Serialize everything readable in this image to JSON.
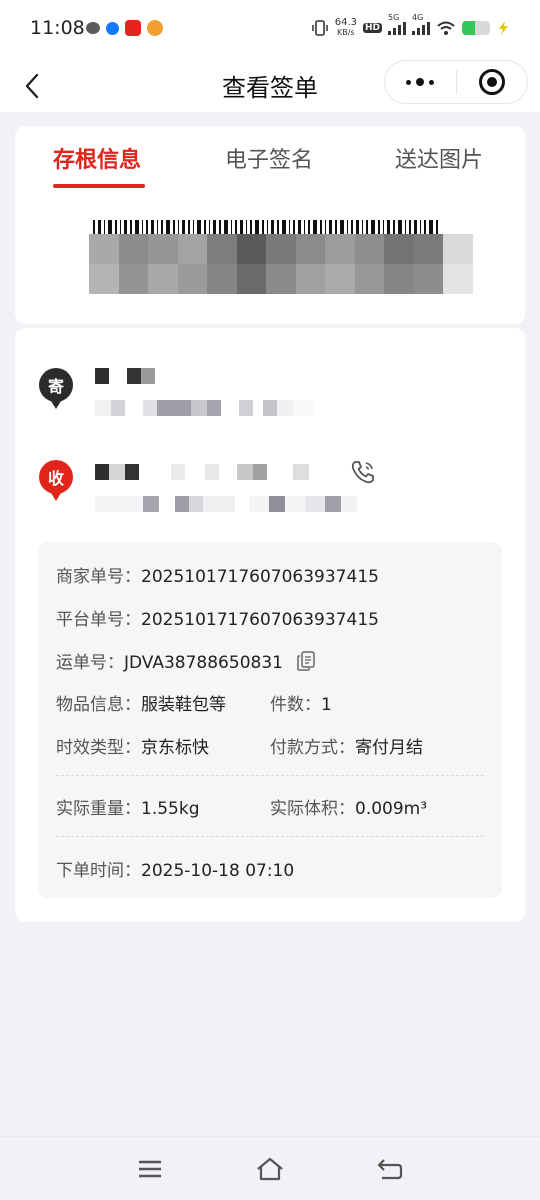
{
  "status_bar": {
    "time": "11:08",
    "net_speed_value": "64.3",
    "net_speed_unit": "KB/s",
    "hd_label": "HD",
    "net_5g": "5G",
    "net_4g": "4G",
    "battery_level": 0.45
  },
  "nav": {
    "title": "查看签单"
  },
  "tabs": [
    {
      "label": "存根信息",
      "active": true
    },
    {
      "label": "电子签名",
      "active": false
    },
    {
      "label": "送达图片",
      "active": false
    }
  ],
  "sender": {
    "badge": "寄"
  },
  "receiver": {
    "badge": "收"
  },
  "order_info": {
    "merchant_no_label": "商家单号：",
    "merchant_no": "2025101717607063937415",
    "platform_no_label": "平台单号：",
    "platform_no": "2025101717607063937415",
    "waybill_label": "运单号：",
    "waybill_no": "JDVA38788650831",
    "goods_label": "物品信息：",
    "goods_value": "服装鞋包等",
    "pieces_label": "件数：",
    "pieces_value": "1",
    "service_label": "时效类型：",
    "service_value": "京东标快",
    "payment_label": "付款方式：",
    "payment_value": "寄付月结",
    "weight_label": "实际重量：",
    "weight_value": "1.55kg",
    "volume_label": "实际体积：",
    "volume_value": "0.009m³",
    "order_time_label": "下单时间：",
    "order_time_value": "2025-10-18 07:10"
  },
  "colors": {
    "accent": "#e1251b",
    "sender_badge": "#2b2b2b",
    "background": "#f1f2f6"
  }
}
